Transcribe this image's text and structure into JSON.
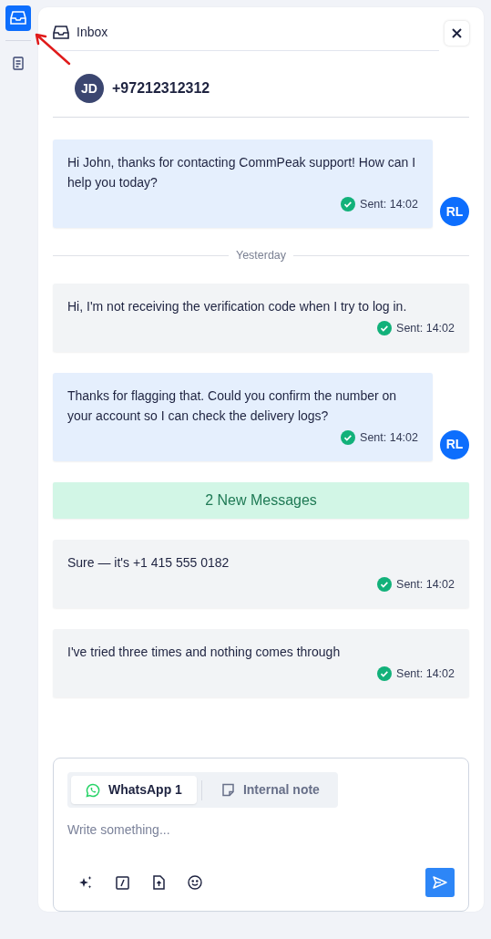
{
  "rail": {
    "items": [
      {
        "kind": "inbox",
        "selected": true
      },
      {
        "kind": "document",
        "selected": false
      }
    ]
  },
  "header": {
    "title": "Inbox"
  },
  "contact": {
    "initials": "JD",
    "name": "+97212312312"
  },
  "messages": [
    {
      "kind": "outgoing",
      "text": "Hi John, thanks for contacting CommPeak support! How can I help you today?",
      "status": "Sent: 14:02",
      "avatar": "RL"
    },
    {
      "kind": "divider",
      "text": "Yesterday"
    },
    {
      "kind": "incoming",
      "text": "Hi, I'm not receiving the verification code when I try to log in.",
      "status": "Sent: 14:02"
    },
    {
      "kind": "outgoing",
      "text": "Thanks for flagging that. Could you confirm the number on your account so I can check the delivery logs?",
      "status": "Sent: 14:02",
      "avatar": "RL"
    },
    {
      "kind": "new",
      "text": "2 New Messages"
    },
    {
      "kind": "incoming",
      "text": "Sure — it's +1 415 555 0182",
      "status": "Sent: 14:02"
    },
    {
      "kind": "incoming",
      "text": "I've tried three times and nothing comes through",
      "status": "Sent: 14:02"
    }
  ],
  "composer": {
    "tabs": [
      {
        "kind": "whatsapp",
        "label": "WhatsApp 1",
        "selected": true
      },
      {
        "kind": "note",
        "label": "Internal note",
        "selected": false
      }
    ],
    "placeholder": "Write something..."
  }
}
